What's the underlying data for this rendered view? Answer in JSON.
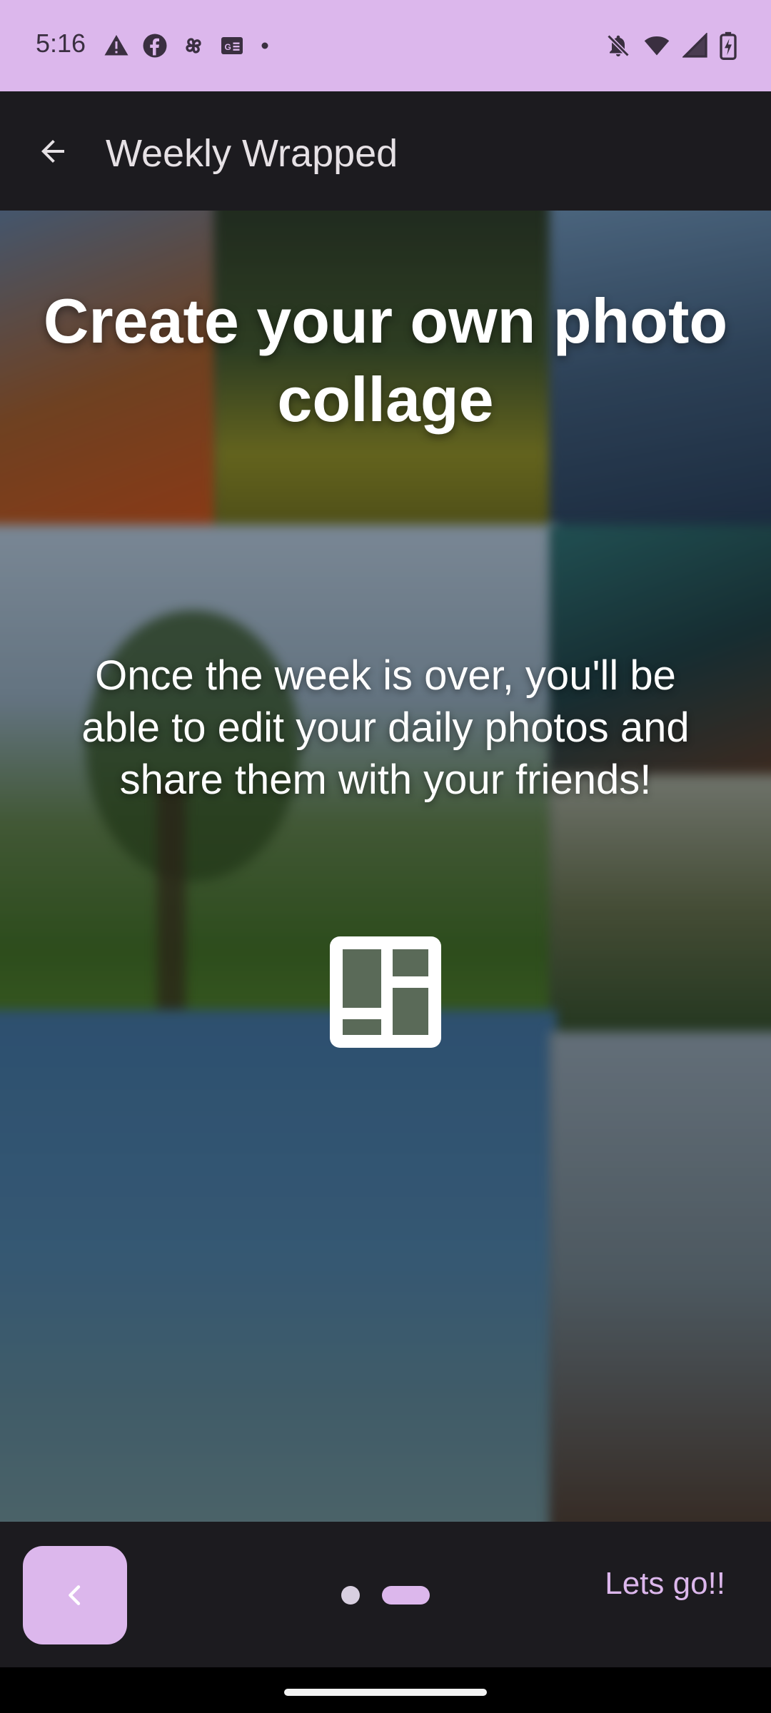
{
  "status_bar": {
    "time": "5:16",
    "left_icons": [
      "alert-icon",
      "facebook-icon",
      "pinwheel-icon",
      "news-icon",
      "dot-icon"
    ],
    "right_icons": [
      "notifications-off-icon",
      "wifi-icon",
      "signal-icon",
      "battery-charging-icon"
    ]
  },
  "app_bar": {
    "title": "Weekly Wrapped",
    "back_icon": "arrow-back-icon"
  },
  "content": {
    "headline": "Create your own photo collage",
    "description": "Once the week is over, you'll be able to edit your daily photos and share them with your friends!",
    "icon": "collage-layout-icon"
  },
  "bottom_bar": {
    "prev_icon": "chevron-left-icon",
    "page_count": 2,
    "current_page": 2,
    "next_label": "Lets go!!"
  },
  "colors": {
    "accent": "#dcb7ec",
    "background": "#1c1b1f",
    "on_surface": "#e6e1e5"
  }
}
